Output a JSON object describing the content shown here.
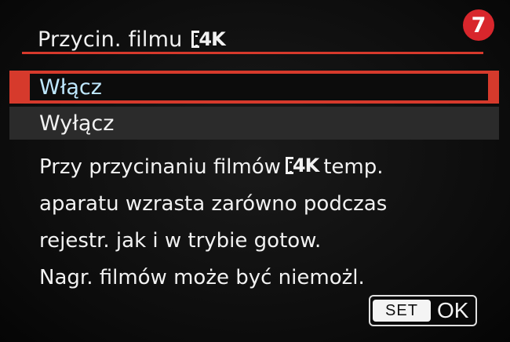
{
  "header": {
    "title": "Przycin. filmu",
    "title_icon": "movie-frame-icon",
    "title_icon_label": "4K",
    "step_badge": "7"
  },
  "menu": {
    "items": [
      {
        "label": "Włącz",
        "selected": true
      },
      {
        "label": "Wyłącz",
        "selected": false
      }
    ]
  },
  "description": {
    "line1_before": "Przy przycinaniu filmów",
    "line1_icon_label": "4K",
    "line1_after": "temp.",
    "line2": "aparatu wzrasta zarówno podczas",
    "line3": "rejestr. jak i w trybie gotow.",
    "line4": "Nagr. filmów może być niemożl."
  },
  "footer": {
    "set_label": "SET",
    "ok_label": "OK"
  },
  "colors": {
    "accent": "#d63a2c",
    "badge": "#d8262c",
    "selected_text": "#bfe8ff",
    "text": "#f2f2f2",
    "background": "#0c0c0c"
  }
}
